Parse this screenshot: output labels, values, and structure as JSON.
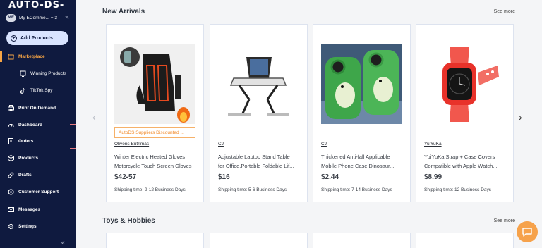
{
  "app": {
    "logo": "AUTO-DS-",
    "store": {
      "badge": "ME",
      "name": "My EComme... + 3"
    },
    "add_products_label": "Add Products",
    "collapse_label": "«"
  },
  "sidebar": {
    "items": [
      {
        "label": "Marketplace",
        "icon": "store-icon",
        "active": true
      },
      {
        "label": "Winning Products",
        "icon": "trophy-icon",
        "sub": true
      },
      {
        "label": "TikTok Spy",
        "icon": "tiktok-icon",
        "sub": true
      },
      {
        "label": "Print On Demand",
        "icon": "print-icon"
      },
      {
        "label": "Dashboard",
        "icon": "gauge-icon"
      },
      {
        "label": "Orders",
        "icon": "orders-icon"
      },
      {
        "label": "Products",
        "icon": "box-icon"
      },
      {
        "label": "Drafts",
        "icon": "drafts-icon"
      },
      {
        "label": "Customer Support",
        "icon": "support-icon"
      },
      {
        "label": "Messages",
        "icon": "mail-icon"
      },
      {
        "label": "Settings",
        "icon": "gear-icon"
      }
    ]
  },
  "sections": [
    {
      "title": "New Arrivals",
      "see_more": "See more",
      "products": [
        {
          "image": "heated-gloves-image",
          "promo": "AutoDS Suppliers Discounted ...",
          "supplier": "Oliveris Butrimas",
          "title_lines": [
            "Winter Electric Heated Gloves",
            "Motorcycle Touch Screen Gloves"
          ],
          "price": "$42-57",
          "shipping": "Shipping time: 9-12 Business Days"
        },
        {
          "image": "laptop-stand-image",
          "promo": "",
          "supplier": "CJ",
          "title_lines": [
            "Adjustable Laptop Stand Table",
            "for Office,Portable Foldable Lif..."
          ],
          "price": "$16",
          "shipping": "Shipping time: 5-6 Business Days"
        },
        {
          "image": "dinosaur-phone-case-image",
          "promo": "",
          "supplier": "CJ",
          "title_lines": [
            "Thickened Anti-fall Applicable",
            "Mobile Phone Case Dinosaur..."
          ],
          "price": "$2.44",
          "shipping": "Shipping time: 7-14 Business Days"
        },
        {
          "image": "watch-strap-image",
          "promo": "",
          "supplier": "YuiYuKa",
          "title_lines": [
            "YuiYuKa Strap + Case Covers",
            "Compatible with Apple Watch..."
          ],
          "price": "$8.99",
          "shipping": "Shipping time: 12 Business Days"
        }
      ]
    },
    {
      "title": "Toys & Hobbies",
      "see_more": "See more"
    }
  ],
  "colors": {
    "sidebar": "#0f1a3f",
    "accent": "#f7a545",
    "promo": "#f28b2a"
  }
}
